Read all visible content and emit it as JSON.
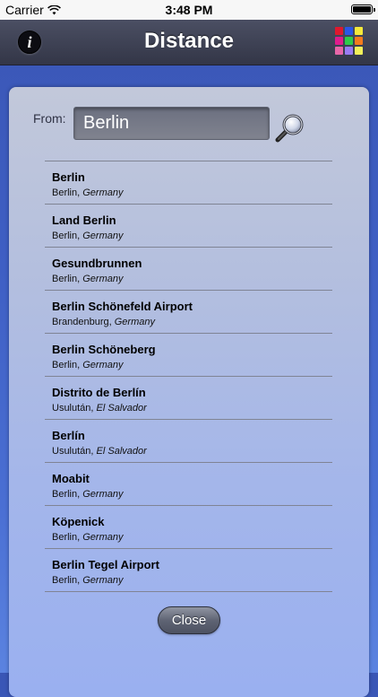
{
  "status_bar": {
    "carrier": "Carrier",
    "time": "3:48 PM",
    "wifi_icon": "wifi-icon",
    "battery_icon": "battery-icon"
  },
  "nav": {
    "title": "Distance",
    "info_label": "i",
    "info_icon": "info-icon",
    "color_grid_icon": "color-grid-icon",
    "color_grid_colors": [
      "#e0182e",
      "#2b56e8",
      "#f4e93a",
      "#e01c8c",
      "#2ecb4a",
      "#f37b1d",
      "#e867a9",
      "#9a7cf4",
      "#f2f05a"
    ]
  },
  "search": {
    "label": "From:",
    "value": "Berlin",
    "icon": "magnifier-icon"
  },
  "results": [
    {
      "name": "Berlin",
      "region": "Berlin,",
      "country": "Germany"
    },
    {
      "name": "Land Berlin",
      "region": "Berlin,",
      "country": "Germany"
    },
    {
      "name": "Gesundbrunnen",
      "region": "Berlin,",
      "country": "Germany"
    },
    {
      "name": "Berlin Schönefeld Airport",
      "region": "Brandenburg,",
      "country": "Germany"
    },
    {
      "name": "Berlin Schöneberg",
      "region": "Berlin,",
      "country": "Germany"
    },
    {
      "name": "Distrito de Berlín",
      "region": "Usulután,",
      "country": "El Salvador"
    },
    {
      "name": "Berlín",
      "region": "Usulután,",
      "country": "El Salvador"
    },
    {
      "name": "Moabit",
      "region": "Berlin,",
      "country": "Germany"
    },
    {
      "name": "Köpenick",
      "region": "Berlin,",
      "country": "Germany"
    },
    {
      "name": "Berlin Tegel Airport",
      "region": "Berlin,",
      "country": "Germany"
    }
  ],
  "close_label": "Close"
}
